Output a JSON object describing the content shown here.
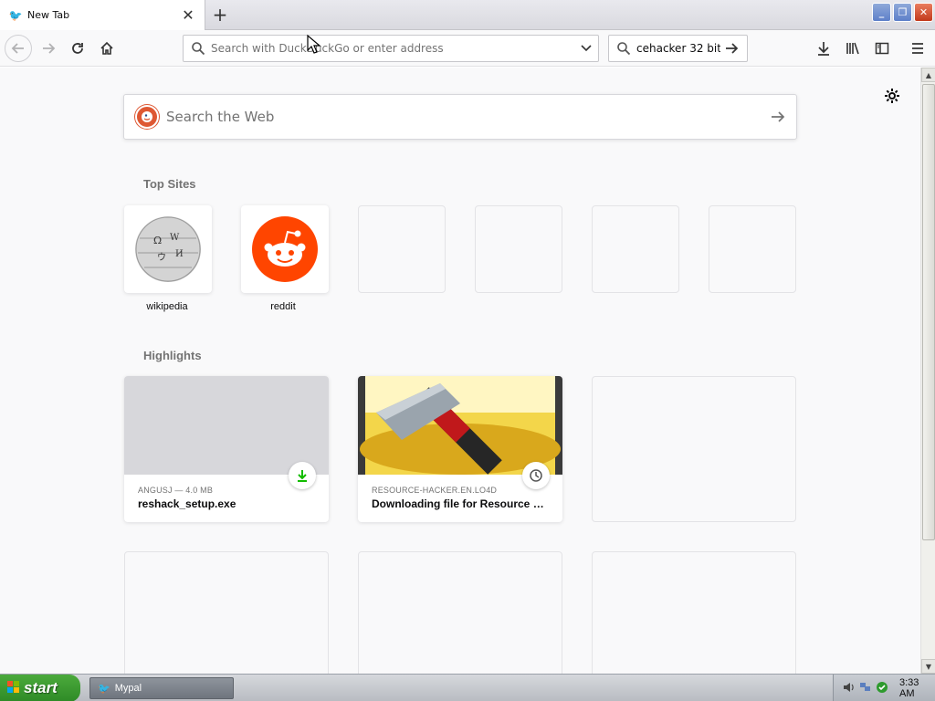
{
  "tab": {
    "title": "New Tab",
    "close_glyph": "✕"
  },
  "tabstrip": {
    "newtab_glyph": "+"
  },
  "window": {
    "minimize": "_",
    "restore": "❐",
    "close": "✕"
  },
  "nav": {
    "back_icon": "arrow-left",
    "forward_icon": "arrow-right",
    "reload_icon": "reload",
    "home_icon": "home"
  },
  "urlbar": {
    "placeholder": "Search with DuckDuckGo or enter address",
    "value": ""
  },
  "searchbar": {
    "value": "cehacker 32 bit,"
  },
  "newtab": {
    "search": {
      "placeholder": "Search the Web",
      "engine_logo": "DuckDuckGo"
    },
    "top_sites": {
      "heading": "Top Sites",
      "items": [
        {
          "label": "wikipedia",
          "icon": "wikipedia-globe-icon"
        },
        {
          "label": "reddit",
          "icon": "reddit-alien-icon"
        },
        {
          "label": ""
        },
        {
          "label": ""
        },
        {
          "label": ""
        },
        {
          "label": ""
        }
      ]
    },
    "highlights": {
      "heading": "Highlights",
      "items": [
        {
          "meta": "ANGUSJ — 4.0 MB",
          "title": "reshack_setup.exe",
          "badge": "download-icon"
        },
        {
          "meta": "RESOURCE-HACKER.EN.LO4D",
          "title": "Downloading file for Resource Hacker",
          "badge": "clock-icon"
        }
      ]
    }
  },
  "taskbar": {
    "start_label": "start",
    "task": {
      "label": "Mypal"
    },
    "clock": "3:33 AM"
  },
  "colors": {
    "accent_download": "#12bc00",
    "reddit": "#ff4500",
    "duckduckgo": "#de5833",
    "xp_start": "#3c9a2f"
  }
}
